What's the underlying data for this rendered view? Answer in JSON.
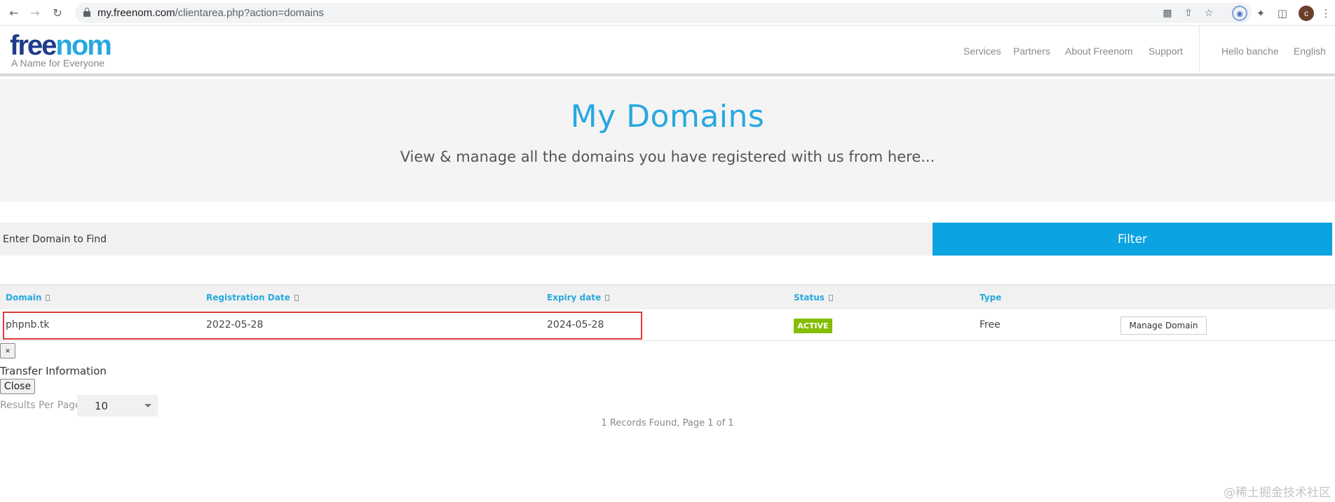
{
  "browser": {
    "url_host": "my.freenom.com",
    "url_path": "/clientarea.php?action=domains",
    "avatar_letter": "c",
    "icons": [
      "back-icon",
      "forward-icon",
      "reload-icon",
      "lock-icon",
      "translate-icon",
      "share-icon",
      "star-icon",
      "extension-icon",
      "puzzle-icon",
      "sidepanel-icon",
      "menu-icon"
    ]
  },
  "header": {
    "logo_free": "free",
    "logo_nom": "nom",
    "tagline": "A Name for Everyone",
    "nav": [
      "Services",
      "Partners",
      "About Freenom",
      "Support"
    ],
    "greeting": "Hello banche",
    "language": "English"
  },
  "hero": {
    "title": "My Domains",
    "subtitle": "View & manage all the domains you have registered with us from here..."
  },
  "search": {
    "placeholder": "Enter Domain to Find",
    "filter_label": "Filter"
  },
  "table": {
    "columns": [
      "Domain",
      "Registration Date",
      "Expiry date",
      "Status",
      "Type"
    ],
    "rows": [
      {
        "domain": "phpnb.tk",
        "registration_date": "2022-05-28",
        "expiry_date": "2024-05-28",
        "status": "ACTIVE",
        "type": "Free",
        "action": "Manage Domain"
      }
    ]
  },
  "transfer": {
    "close_x": "×",
    "title": "Transfer Information",
    "close_label": "Close"
  },
  "pagination": {
    "results_label": "Results Per Page:",
    "per_page": "10",
    "records_text": "1 Records Found, Page 1 of 1"
  },
  "colors": {
    "brand_blue": "#27a8e0",
    "filter_blue": "#0ba3e1",
    "logo_dark": "#1f3b8a",
    "active_green": "#84bd00",
    "highlight_red": "#e03a3a"
  },
  "watermark": "@稀土掘金技术社区"
}
